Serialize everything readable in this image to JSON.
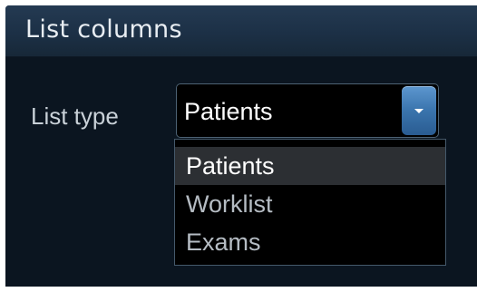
{
  "panel": {
    "title": "List columns"
  },
  "list_type": {
    "label": "List type",
    "selected_value": "Patients",
    "options": [
      "Patients",
      "Worklist",
      "Exams"
    ],
    "highlighted_index": 0,
    "arrow_icon": "chevron-down-icon"
  },
  "colors": {
    "panel_bg": "#0b1520",
    "header_bg": "#1c3046",
    "accent_blue": "#3a74ad",
    "text_primary": "#ffffff",
    "text_secondary": "#b5bcc3"
  }
}
